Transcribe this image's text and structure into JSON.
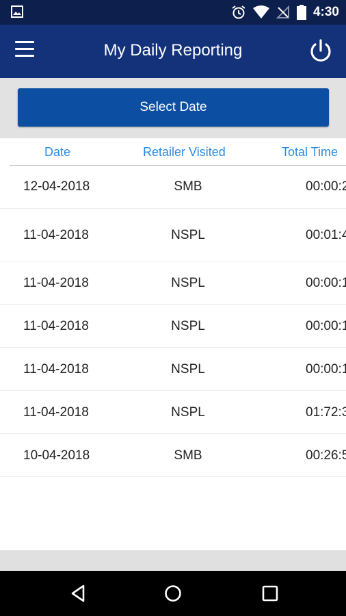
{
  "status_bar": {
    "time": "4:30",
    "icons": [
      "image-icon",
      "alarm-icon",
      "wifi-icon",
      "no-signal-icon",
      "battery-icon"
    ]
  },
  "app_bar": {
    "title": "My Daily Reporting",
    "menu_icon": "menu-icon",
    "power_icon": "power-icon"
  },
  "select_date_label": "Select Date",
  "table": {
    "headers": [
      "Date",
      "Retailer Visited",
      "Total Time"
    ],
    "rows": [
      {
        "date": "12-04-2018",
        "retailer": "SMB",
        "time": "00:00:2"
      },
      {
        "date": "11-04-2018",
        "retailer": "NSPL",
        "time": "00:01:4"
      },
      {
        "date": "11-04-2018",
        "retailer": "NSPL",
        "time": "00:00:1"
      },
      {
        "date": "11-04-2018",
        "retailer": "NSPL",
        "time": "00:00:1"
      },
      {
        "date": "11-04-2018",
        "retailer": "NSPL",
        "time": "00:00:1"
      },
      {
        "date": "11-04-2018",
        "retailer": "NSPL",
        "time": "01:72:3"
      },
      {
        "date": "10-04-2018",
        "retailer": "SMB",
        "time": "00:26:5"
      }
    ]
  },
  "nav_bar": {
    "icons": [
      "back-icon",
      "home-icon",
      "recents-icon"
    ]
  },
  "colors": {
    "status_bar": "#0d1f4d",
    "app_bar": "#13327a",
    "button": "#0b4ea2",
    "header_text": "#2a8be0"
  }
}
